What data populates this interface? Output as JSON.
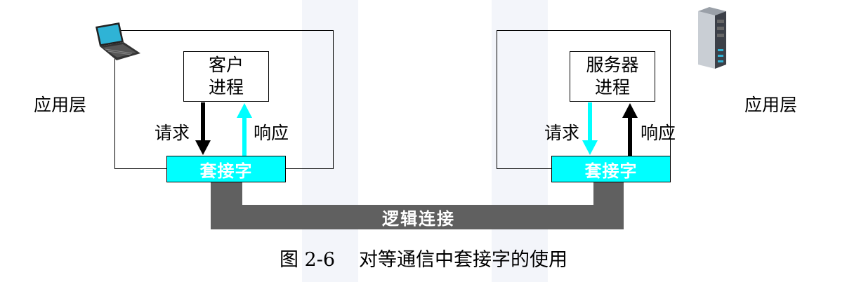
{
  "left": {
    "layer_label": "应用层",
    "process_label": "客户\n进程",
    "request_label": "请求",
    "response_label": "响应",
    "socket_label": "套接字",
    "device_icon": "laptop-icon"
  },
  "right": {
    "layer_label": "应用层",
    "process_label": "服务器\n进程",
    "request_label": "请求",
    "response_label": "响应",
    "socket_label": "套接字",
    "device_icon": "server-icon"
  },
  "connection_label": "逻辑连接",
  "caption": {
    "figure": "图 2-6",
    "text": "对等通信中套接字的使用"
  },
  "colors": {
    "socket_fill": "#00ffff",
    "connection": "#606060",
    "request_arrow_left": "#000000",
    "response_arrow_left": "#00ffff"
  }
}
